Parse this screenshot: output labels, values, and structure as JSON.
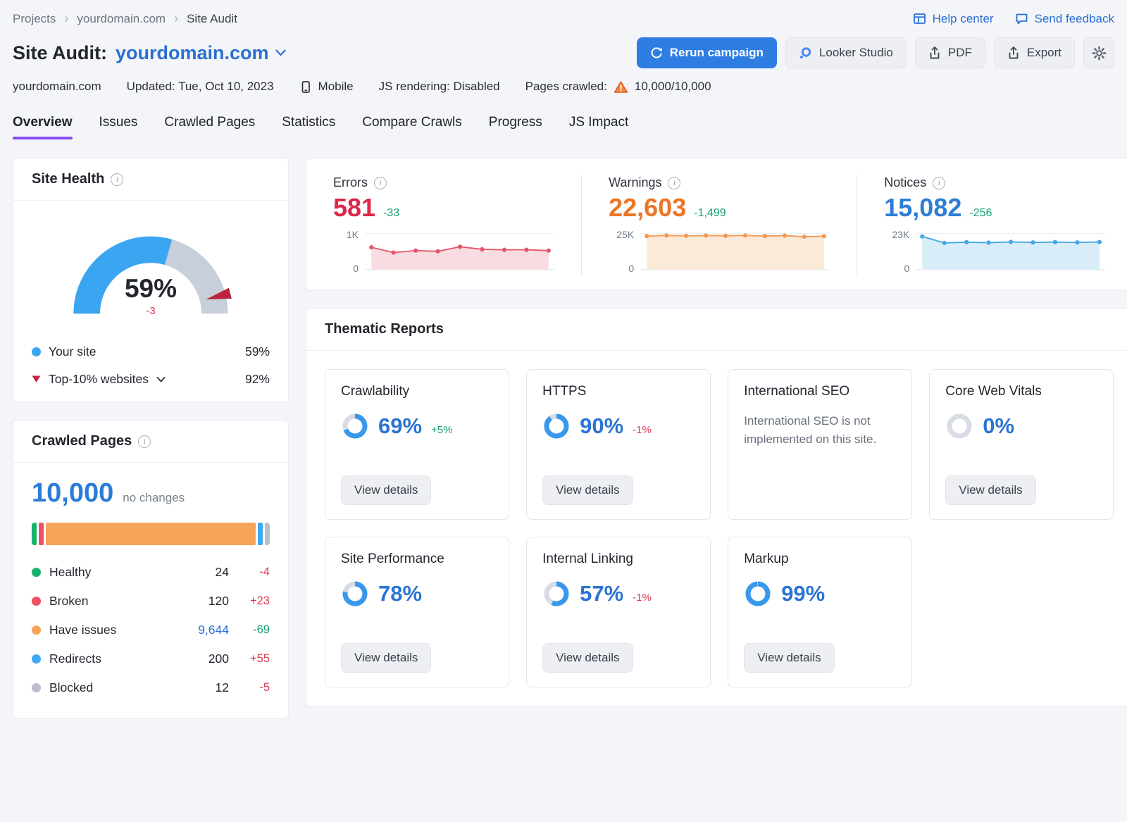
{
  "breadcrumb": {
    "items": [
      "Projects",
      "yourdomain.com",
      "Site Audit"
    ]
  },
  "toplinks": {
    "help": "Help center",
    "feedback": "Send feedback"
  },
  "header": {
    "title": "Site Audit:",
    "domain": "yourdomain.com",
    "rerun": "Rerun campaign",
    "looker": "Looker Studio",
    "pdf": "PDF",
    "export": "Export"
  },
  "meta": {
    "domain": "yourdomain.com",
    "updated": "Updated: Tue, Oct 10, 2023",
    "device": "Mobile",
    "js_rendering": "JS rendering: Disabled",
    "pages_label": "Pages crawled:",
    "pages_value": "10,000/10,000"
  },
  "tabs": [
    "Overview",
    "Issues",
    "Crawled Pages",
    "Statistics",
    "Compare Crawls",
    "Progress",
    "JS Impact"
  ],
  "site_health": {
    "title": "Site Health",
    "score": "59%",
    "score_pct": 59,
    "delta": "-3",
    "benchmark_pct": 92,
    "legend_site_label": "Your site",
    "legend_site_value": "59%",
    "legend_top_label": "Top-10% websites",
    "legend_top_value": "92%",
    "gauge_color": "#3aa6f2",
    "track_color": "#c9cfda",
    "marker_color": "#b92441"
  },
  "crawled_pages": {
    "title": "Crawled Pages",
    "total": "10,000",
    "note": "no changes",
    "rows": [
      {
        "label": "Healthy",
        "value": "24",
        "num": 24,
        "delta": "-4",
        "delta_kind": "bad",
        "color": "#17b26a",
        "link": false
      },
      {
        "label": "Broken",
        "value": "120",
        "num": 120,
        "delta": "+23",
        "delta_kind": "bad",
        "color": "#ef5063",
        "link": false
      },
      {
        "label": "Have issues",
        "value": "9,644",
        "num": 9644,
        "delta": "-69",
        "delta_kind": "good",
        "color": "#f6a45a",
        "link": true
      },
      {
        "label": "Redirects",
        "value": "200",
        "num": 200,
        "delta": "+55",
        "delta_kind": "bad",
        "color": "#3da8f5",
        "link": false
      },
      {
        "label": "Blocked",
        "value": "12",
        "num": 12,
        "delta": "-5",
        "delta_kind": "bad",
        "color": "#b9bfca",
        "link": false
      }
    ]
  },
  "issues_summary": [
    {
      "label": "Errors",
      "value": "581",
      "delta": "-33",
      "ymax_label": "1K",
      "ymin_label": "0",
      "ymax": 1000,
      "points": [
        615,
        470,
        525,
        505,
        630,
        560,
        545,
        545,
        525
      ],
      "value_color": "#dd2749",
      "line_color": "#e4546b",
      "fill_color": "#f9dce1"
    },
    {
      "label": "Warnings",
      "value": "22,603",
      "delta": "-1,499",
      "ymax_label": "25K",
      "ymin_label": "0",
      "ymax": 25000,
      "points": [
        23100,
        23500,
        23250,
        23450,
        23300,
        23500,
        23150,
        23400,
        22650,
        23000
      ],
      "value_color": "#ee7525",
      "line_color": "#f09a55",
      "fill_color": "#fcead8"
    },
    {
      "label": "Notices",
      "value": "15,082",
      "delta": "-256",
      "ymax_label": "23K",
      "ymin_label": "0",
      "ymax": 23000,
      "points": [
        21000,
        16900,
        17400,
        17050,
        17550,
        17200,
        17450,
        17200,
        17500
      ],
      "value_color": "#2e7dd3",
      "line_color": "#43a8e6",
      "fill_color": "#d9edf9"
    }
  ],
  "thematic": {
    "title": "Thematic Reports",
    "view_details": "View details",
    "donut_color": "#3898ec",
    "donut_track": "#d7dce5",
    "cards": [
      {
        "label": "Crawlability",
        "pct": 69,
        "pct_label": "69%",
        "delta": "+5%",
        "delta_kind": "good",
        "has_button": true
      },
      {
        "label": "HTTPS",
        "pct": 90,
        "pct_label": "90%",
        "delta": "-1%",
        "delta_kind": "bad",
        "has_button": true
      },
      {
        "label": "International SEO",
        "text": "International SEO is not implemented on this site.",
        "has_button": false
      },
      {
        "label": "Core Web Vitals",
        "pct": 0,
        "pct_label": "0%",
        "has_button": true
      },
      {
        "label": "Site Performance",
        "pct": 78,
        "pct_label": "78%",
        "has_button": true
      },
      {
        "label": "Internal Linking",
        "pct": 57,
        "pct_label": "57%",
        "delta": "-1%",
        "delta_kind": "bad",
        "has_button": true
      },
      {
        "label": "Markup",
        "pct": 99,
        "pct_label": "99%",
        "has_button": true
      }
    ]
  }
}
